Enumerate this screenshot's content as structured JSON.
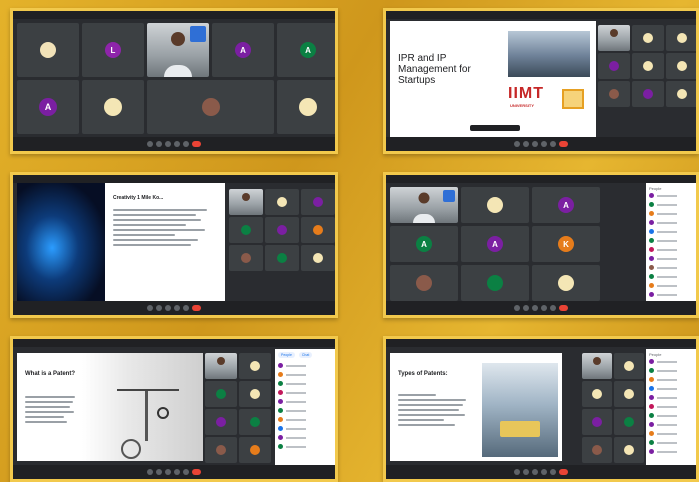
{
  "collage": {
    "slide2": {
      "title": "IPR and IP Management for Startups",
      "logo": "IIMT",
      "logo_sub": "UNIVERSITY"
    },
    "slide3": {
      "heading": "Creativity 1 Mile Ko..."
    },
    "slide5": {
      "title": "What is a Patent?"
    },
    "slide6": {
      "title": "Types of Patents:"
    },
    "avatars": {
      "a": {
        "letter": "A",
        "color": "#7b1fa2"
      },
      "a_green": {
        "letter": "A",
        "color": "#0b8043"
      },
      "l": {
        "letter": "L",
        "color": "#8e24aa"
      },
      "k": {
        "letter": "K",
        "color": "#e67c1b"
      }
    },
    "panel": {
      "tab_people": "People",
      "tab_chat": "Chat"
    }
  }
}
